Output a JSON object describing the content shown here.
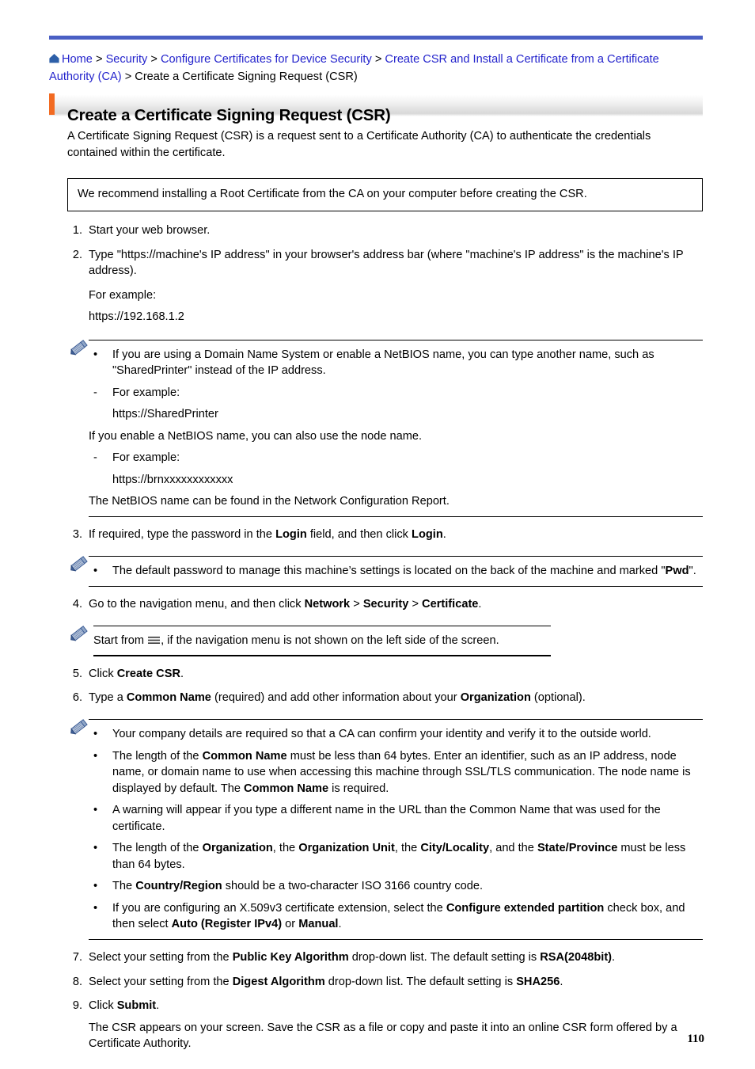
{
  "breadcrumb": {
    "home_icon": "home-icon",
    "items": [
      {
        "label": "Home",
        "link": true
      },
      {
        "label": "Security",
        "link": true
      },
      {
        "label": "Configure Certificates for Device Security",
        "link": true
      },
      {
        "label": "Create CSR and Install a Certificate from a Certificate Authority (CA)",
        "link": true
      },
      {
        "label": "Create a Certificate Signing Request (CSR)",
        "link": false
      }
    ],
    "separator": ">"
  },
  "heading": {
    "title": "Create a Certificate Signing Request (CSR)",
    "accent_color": "#f26a21",
    "rule_color": "#4a5fc4"
  },
  "intro": "A Certificate Signing Request (CSR) is a request sent to a Certificate Authority (CA) to authenticate the credentials contained within the certificate.",
  "callout": "We recommend installing a Root Certificate from the CA on your computer before creating the CSR.",
  "steps": [
    {
      "num": "1.",
      "text": "Start your web browser."
    },
    {
      "num": "2.",
      "text": "Type \"https://machine's IP address\" in your browser's address bar (where \"machine's IP address\" is the machine's IP address).",
      "sub": [
        "For example:",
        "https://192.168.1.2"
      ]
    },
    {
      "num": "3.",
      "prefix": "If required, type the password in the ",
      "bold1": "Login",
      "mid": " field, and then click ",
      "bold2": "Login",
      "suffix": "."
    },
    {
      "num": "4.",
      "prefix": "Go to the navigation menu, and then click ",
      "bold1": "Network",
      "sep1": " > ",
      "bold2": "Security",
      "sep2": " > ",
      "bold3": "Certificate",
      "suffix": "."
    },
    {
      "num": "5.",
      "prefix": "Click ",
      "bold1": "Create CSR",
      "suffix": "."
    },
    {
      "num": "6.",
      "prefix": "Type a ",
      "bold1": "Common Name",
      "mid": " (required) and add other information about your ",
      "bold2": "Organization",
      "suffix": " (optional)."
    },
    {
      "num": "7.",
      "prefix": "Select your setting from the ",
      "bold1": "Public Key Algorithm",
      "mid": " drop-down list. The default setting is ",
      "bold2": "RSA(2048bit)",
      "suffix": "."
    },
    {
      "num": "8.",
      "prefix": "Select your setting from the ",
      "bold1": "Digest Algorithm",
      "mid": " drop-down list. The default setting is ",
      "bold2": "SHA256",
      "suffix": "."
    },
    {
      "num": "9.",
      "prefix": "Click ",
      "bold1": "Submit",
      "suffix": ".",
      "sub": [
        "The CSR appears on your screen. Save the CSR as a file or copy and paste it into an online CSR form offered by a Certificate Authority."
      ]
    }
  ],
  "note_netbios": {
    "icon": "pencil-icon",
    "bullet1": "If you are using a Domain Name System or enable a NetBIOS name, you can type another name, such as \"SharedPrinter\" instead of the IP address.",
    "dash1_label": "For example:",
    "dash1_value": "https://SharedPrinter",
    "plain1": "If you enable a NetBIOS name, you can also use the node name.",
    "dash2_label": "For example:",
    "dash2_value": "https://brnxxxxxxxxxxxx",
    "plain2": "The NetBIOS name can be found in the Network Configuration Report."
  },
  "note_password": {
    "icon": "pencil-icon",
    "part1": "The default password to manage this machine’s settings is located on the back of the machine and marked \"",
    "bold": "Pwd",
    "part2": "\"."
  },
  "note_nav": {
    "icon": "pencil-icon",
    "part1": "Start from ",
    "glyph": "hamburger-icon",
    "part2": ", if the navigation menu is not shown on the left side of the screen."
  },
  "note_company": {
    "icon": "pencil-icon",
    "bullets": [
      {
        "parts": [
          {
            "t": "Your company details are required so that a CA can confirm your identity and verify it to the outside world.",
            "b": false
          }
        ]
      },
      {
        "parts": [
          {
            "t": "The length of the ",
            "b": false
          },
          {
            "t": "Common Name",
            "b": true
          },
          {
            "t": " must be less than 64 bytes. Enter an identifier, such as an IP address, node name, or domain name to use when accessing this machine through SSL/TLS communication. The node name is displayed by default. The ",
            "b": false
          },
          {
            "t": "Common Name",
            "b": true
          },
          {
            "t": " is required.",
            "b": false
          }
        ]
      },
      {
        "parts": [
          {
            "t": "A warning will appear if you type a different name in the URL than the Common Name that was used for the certificate.",
            "b": false
          }
        ]
      },
      {
        "parts": [
          {
            "t": "The length of the ",
            "b": false
          },
          {
            "t": "Organization",
            "b": true
          },
          {
            "t": ", the ",
            "b": false
          },
          {
            "t": "Organization Unit",
            "b": true
          },
          {
            "t": ", the ",
            "b": false
          },
          {
            "t": "City/Locality",
            "b": true
          },
          {
            "t": ", and the ",
            "b": false
          },
          {
            "t": "State/Province",
            "b": true
          },
          {
            "t": " must be less than 64 bytes.",
            "b": false
          }
        ]
      },
      {
        "parts": [
          {
            "t": "The ",
            "b": false
          },
          {
            "t": "Country/Region",
            "b": true
          },
          {
            "t": " should be a two-character ISO 3166 country code.",
            "b": false
          }
        ]
      },
      {
        "parts": [
          {
            "t": "If you are configuring an X.509v3 certificate extension, select the ",
            "b": false
          },
          {
            "t": "Configure extended partition",
            "b": true
          },
          {
            "t": " check box, and then select ",
            "b": false
          },
          {
            "t": "Auto (Register IPv4)",
            "b": true
          },
          {
            "t": " or ",
            "b": false
          },
          {
            "t": "Manual",
            "b": true
          },
          {
            "t": ".",
            "b": false
          }
        ]
      }
    ]
  },
  "footer": {
    "page_number": "110"
  },
  "symbols": {
    "bullet": "•",
    "dash": "-"
  }
}
